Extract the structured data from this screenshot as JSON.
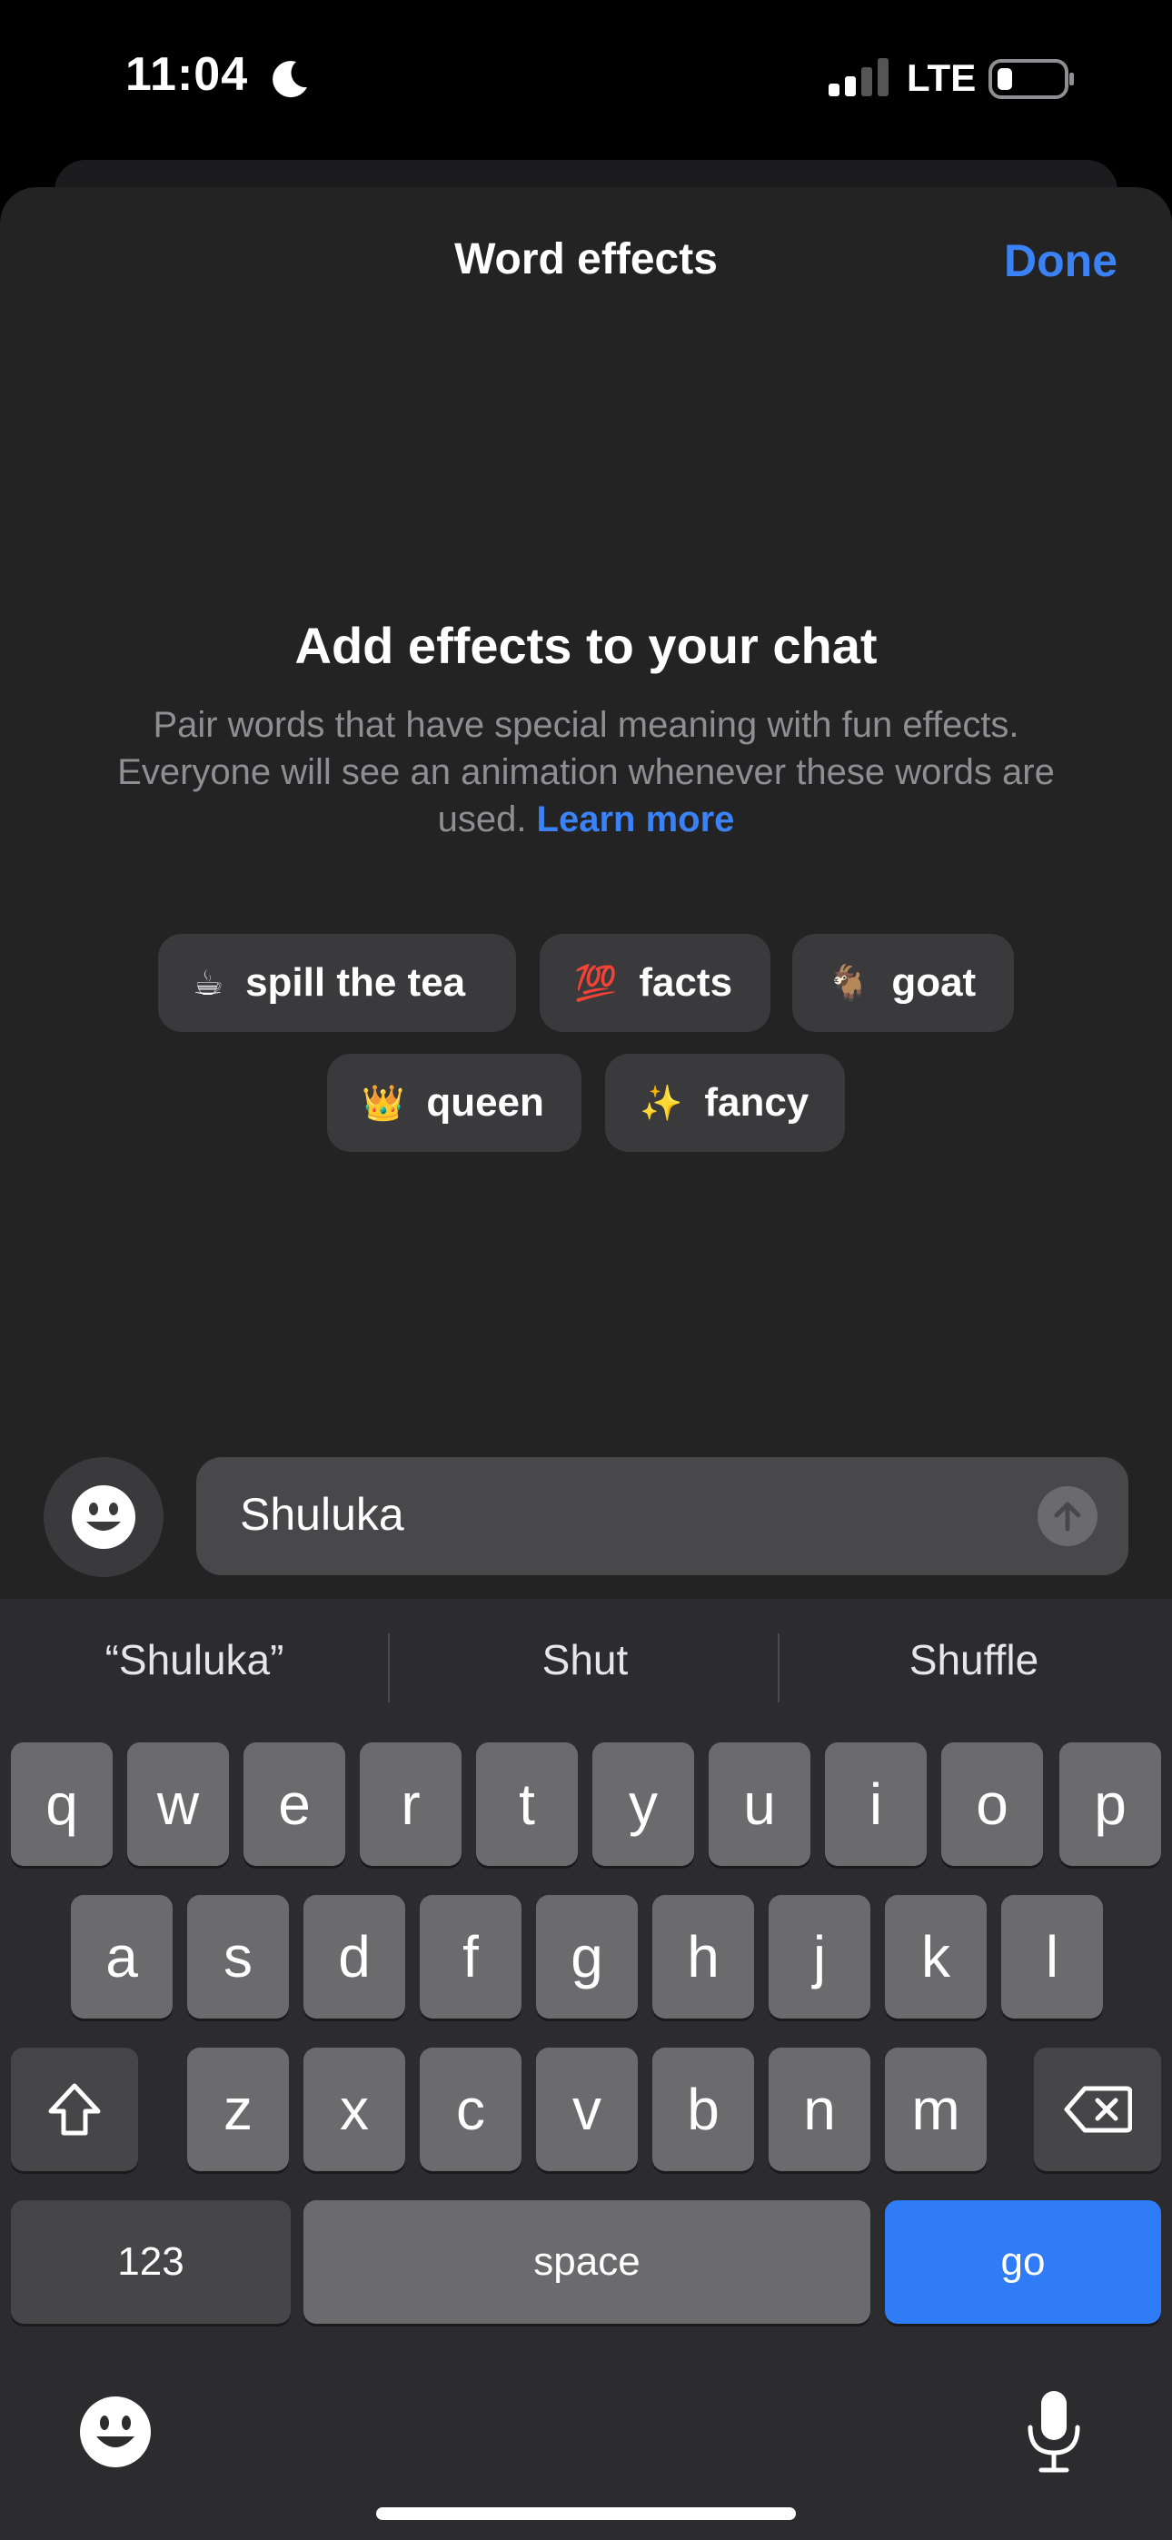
{
  "status_bar": {
    "time": "11:04",
    "network": "LTE",
    "icons": [
      "moon-icon",
      "signal-icon",
      "battery-icon"
    ]
  },
  "sheet": {
    "title": "Word effects",
    "done_label": "Done",
    "headline": "Add effects to your chat",
    "description": "Pair words that have special meaning with fun effects. Everyone will see an animation whenever these words are used.",
    "learn_more": "Learn more"
  },
  "chips": [
    {
      "emoji": "☕",
      "label": "spill the tea"
    },
    {
      "emoji": "💯",
      "label": "facts"
    },
    {
      "emoji": "🐐",
      "label": "goat"
    },
    {
      "emoji": "👑",
      "label": "queen"
    },
    {
      "emoji": "✨",
      "label": "fancy"
    }
  ],
  "input": {
    "value": "Shuluka"
  },
  "suggestions": [
    "“Shuluka”",
    "Shut",
    "Shuffle"
  ],
  "keyboard": {
    "row1": [
      "q",
      "w",
      "e",
      "r",
      "t",
      "y",
      "u",
      "i",
      "o",
      "p"
    ],
    "row2": [
      "a",
      "s",
      "d",
      "f",
      "g",
      "h",
      "j",
      "k",
      "l"
    ],
    "row3": [
      "z",
      "x",
      "c",
      "v",
      "b",
      "n",
      "m"
    ],
    "numbers_label": "123",
    "space_label": "space",
    "go_label": "go"
  },
  "colors": {
    "accent": "#3b82f6",
    "go_key": "#2f7cf6",
    "sheet_bg": "#232324",
    "keyboard_bg": "#2c2c2e"
  }
}
